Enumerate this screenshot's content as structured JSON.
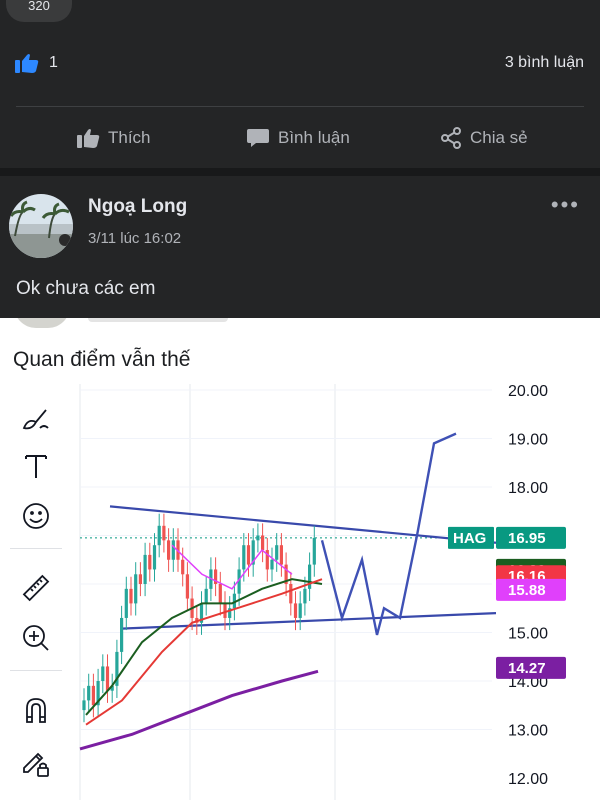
{
  "post1": {
    "pill_label": "320",
    "like_count": "1",
    "comment_count": "3 bình luận",
    "actions": {
      "like": "Thích",
      "comment": "Bình luận",
      "share": "Chia sẻ"
    },
    "colors": {
      "like_blue": "#2d88ff",
      "text_secondary": "#b0b3b8"
    }
  },
  "post2": {
    "author": "Ngoạ Long",
    "timestamp": "3/11 lúc 16:02",
    "more_label": "•••",
    "text": "Ok chưa các em"
  },
  "shared_image": {
    "caption": "Quan điểm vẫn thế",
    "toolbar_icons": [
      "brush-icon",
      "text-icon",
      "emoji-icon",
      "ruler-icon",
      "zoom-in-icon",
      "magnet-icon",
      "lock-pencil-icon"
    ]
  },
  "chart_data": {
    "type": "line",
    "symbol": "HAG",
    "y_axis_labels": [
      "20.00",
      "19.00",
      "18.00",
      "15.00",
      "14.00",
      "13.00",
      "12.00"
    ],
    "ylim": [
      12,
      20
    ],
    "price_tags": [
      {
        "label": "16.95",
        "value": 16.95,
        "color": "#089981",
        "name": "HAG"
      },
      {
        "label": "16.29",
        "value": 16.29,
        "color": "#1b5e20"
      },
      {
        "label": "16.16",
        "value": 16.16,
        "color": "#f23645"
      },
      {
        "label": "15.88",
        "value": 15.88,
        "color": "#e040fb"
      },
      {
        "label": "14.27",
        "value": 14.27,
        "color": "#7b1fa2"
      }
    ],
    "grid": true
  }
}
